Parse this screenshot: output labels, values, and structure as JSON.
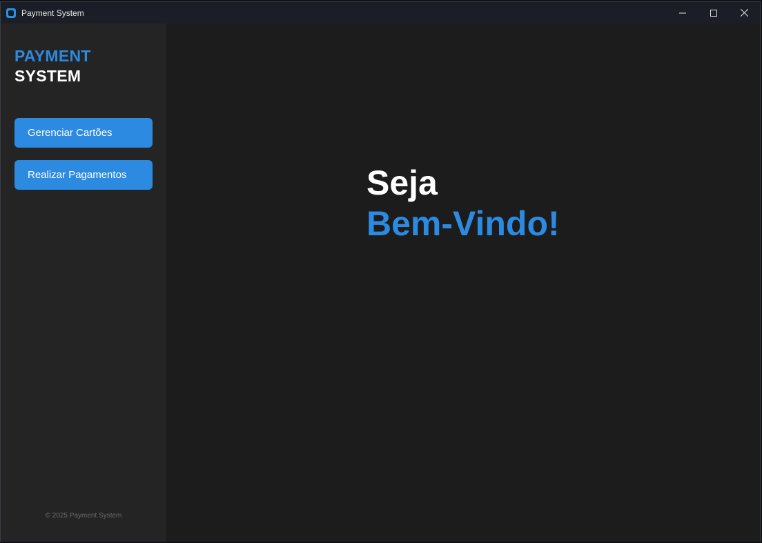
{
  "window": {
    "title": "Payment System"
  },
  "sidebar": {
    "brand_line1": "PAYMENT",
    "brand_line2": "SYSTEM",
    "buttons": [
      {
        "label": "Gerenciar Cartões"
      },
      {
        "label": "Realizar Pagamentos"
      }
    ],
    "footer": "© 2025 Payment System"
  },
  "main": {
    "welcome_line1": "Seja",
    "welcome_line2": "Bem-Vindo!"
  },
  "colors": {
    "accent": "#2c8ae0",
    "sidebar_bg": "#242424",
    "main_bg": "#1c1c1c"
  }
}
